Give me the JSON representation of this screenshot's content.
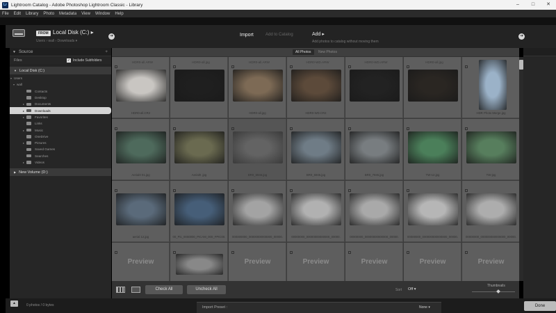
{
  "window": {
    "title": "Lightroom Catalog - Adobe Photoshop Lightroom Classic - Library",
    "icon_text": "Lr"
  },
  "menu": [
    "File",
    "Edit",
    "Library",
    "Photo",
    "Metadata",
    "View",
    "Window",
    "Help"
  ],
  "header": {
    "from_label": "FROM",
    "source_title": "Local Disk (C:) ▸",
    "source_path": "Users › wall › Downloads ▾",
    "mode_import": "Import",
    "mode_catalog": "Add to Catalog",
    "mode_add": "Add ▸",
    "mode_desc": "Add photos to catalog without moving them"
  },
  "source_panel": {
    "title": "Source",
    "files_label": "Files",
    "include_subfolders": "Include Subfolders",
    "drive": "Local Disk (C:)",
    "tree": [
      {
        "label": "Users",
        "indent": 0,
        "exp": "▾",
        "selected": false
      },
      {
        "label": "wall",
        "indent": 1,
        "exp": "▾",
        "selected": false
      },
      {
        "label": "Contacts",
        "indent": 2,
        "exp": "",
        "selected": false
      },
      {
        "label": "Desktop",
        "indent": 2,
        "exp": "",
        "selected": false
      },
      {
        "label": "Documents",
        "indent": 2,
        "exp": "▸",
        "selected": false
      },
      {
        "label": "Downloads",
        "indent": 2,
        "exp": "▸",
        "selected": true
      },
      {
        "label": "Favorites",
        "indent": 2,
        "exp": "▸",
        "selected": false
      },
      {
        "label": "Links",
        "indent": 2,
        "exp": "",
        "selected": false
      },
      {
        "label": "Music",
        "indent": 2,
        "exp": "▸",
        "selected": false
      },
      {
        "label": "OneDrive",
        "indent": 2,
        "exp": "",
        "selected": false
      },
      {
        "label": "Pictures",
        "indent": 2,
        "exp": "▸",
        "selected": false
      },
      {
        "label": "Saved Games",
        "indent": 2,
        "exp": "",
        "selected": false
      },
      {
        "label": "Searches",
        "indent": 2,
        "exp": "",
        "selected": false
      },
      {
        "label": "Videos",
        "indent": 2,
        "exp": "▸",
        "selected": false
      }
    ],
    "drive2": "New Volume (D:)"
  },
  "filters": {
    "all": "All Photos",
    "new": "New Photos"
  },
  "grid": {
    "rows": [
      [
        {
          "num": "HDR0-all.ARW",
          "name": "HDR0-all.CR2",
          "color": "#c9c6c2",
          "kind": "wide",
          "dim": false
        },
        {
          "num": "HDR0-all.jpg",
          "name": "",
          "color": "#1f1f1f",
          "kind": "wide",
          "dim": false
        },
        {
          "num": "HDR0-all.ARW",
          "name": "HDR0-all.jpg",
          "color": "#7d6a55",
          "kind": "wide",
          "dim": false
        },
        {
          "num": "HDR0-WD.ARW",
          "name": "HDR0-WD.CR2",
          "color": "#5c4a3a",
          "kind": "wide",
          "dim": false
        },
        {
          "num": "HDR0-WD.ARW",
          "name": "",
          "color": "#222222",
          "kind": "wide",
          "dim": false
        },
        {
          "num": "HDR0-all.jpg",
          "name": "",
          "color": "#2a2622",
          "kind": "wide",
          "dim": false
        },
        {
          "num": "HDR0-all.jpg",
          "name": "HDR Photo Merge.jpg",
          "color": "#9bb2c8",
          "kind": "tall",
          "dim": false
        }
      ],
      [
        {
          "num": "",
          "name": "Aerial0 01.jpg",
          "color": "#4e6a5c",
          "kind": "wide",
          "dim": false
        },
        {
          "num": "",
          "name": "Aerial0 .jpg",
          "color": "#6a6a50",
          "kind": "wide",
          "dim": false
        },
        {
          "num": "",
          "name": "BR0_6946.jpg",
          "color": "#6e6e6e",
          "kind": "wide",
          "dim": true
        },
        {
          "num": "",
          "name": "BR0_6945.jpg",
          "color": "#6f7c86",
          "kind": "wide",
          "dim": false
        },
        {
          "num": "",
          "name": "BR0_7945.jpg",
          "color": "#787d80",
          "kind": "wide",
          "dim": false
        },
        {
          "num": "",
          "name": "TW-12.jpg",
          "color": "#4b7f5a",
          "kind": "wide",
          "dim": false
        },
        {
          "num": "",
          "name": "TW-jpg",
          "color": "#577e5d",
          "kind": "wide",
          "dim": false
        }
      ],
      [
        {
          "num": "",
          "name": "aerial 12.jpg",
          "color": "#5a6a7a",
          "kind": "wide",
          "dim": false
        },
        {
          "num": "",
          "name": "00_Pic_0000000_PICAM_000_FPIC00.",
          "color": "#465e78",
          "kind": "wide",
          "dim": false
        },
        {
          "num": "",
          "name": "000000000_00000000000000_00000.",
          "color": "#a3a3a3",
          "kind": "wide",
          "dim": false
        },
        {
          "num": "",
          "name": "00000000_00000000000000_00000.",
          "color": "#b1b1b1",
          "kind": "wide",
          "dim": false
        },
        {
          "num": "",
          "name": "00000000_00000000000000_00000.",
          "color": "#a9a9a9",
          "kind": "wide",
          "dim": false
        },
        {
          "num": "",
          "name": "00000000_000000000000000_00000.",
          "color": "#b6b6b6",
          "kind": "wide",
          "dim": false
        },
        {
          "num": "",
          "name": "00000000_000000000000000_00000.",
          "color": "#adadad",
          "kind": "wide",
          "dim": false
        }
      ],
      [
        {
          "num": "",
          "name": "",
          "color": "",
          "kind": "preview",
          "dim": false
        },
        {
          "num": "",
          "name": "",
          "color": "#888888",
          "kind": "wide",
          "dim": false
        },
        {
          "num": "",
          "name": "",
          "color": "",
          "kind": "preview",
          "dim": false
        },
        {
          "num": "",
          "name": "",
          "color": "",
          "kind": "preview",
          "dim": false
        },
        {
          "num": "",
          "name": "",
          "color": "",
          "kind": "preview",
          "dim": false
        },
        {
          "num": "",
          "name": "",
          "color": "",
          "kind": "preview",
          "dim": false
        },
        {
          "num": "",
          "name": "",
          "color": "",
          "kind": "preview",
          "dim": false
        }
      ]
    ],
    "preview_text": "Preview"
  },
  "toolbar": {
    "check_all": "Check All",
    "uncheck_all": "Uncheck All",
    "sort_label": "Sort",
    "sort_value": "Off ▾",
    "thumbnails_label": "Thumbnails"
  },
  "bottom": {
    "count": "0 photos / 0 bytes",
    "preset_label": "Import Preset :",
    "preset_value": "None ▾",
    "done": "Done"
  }
}
